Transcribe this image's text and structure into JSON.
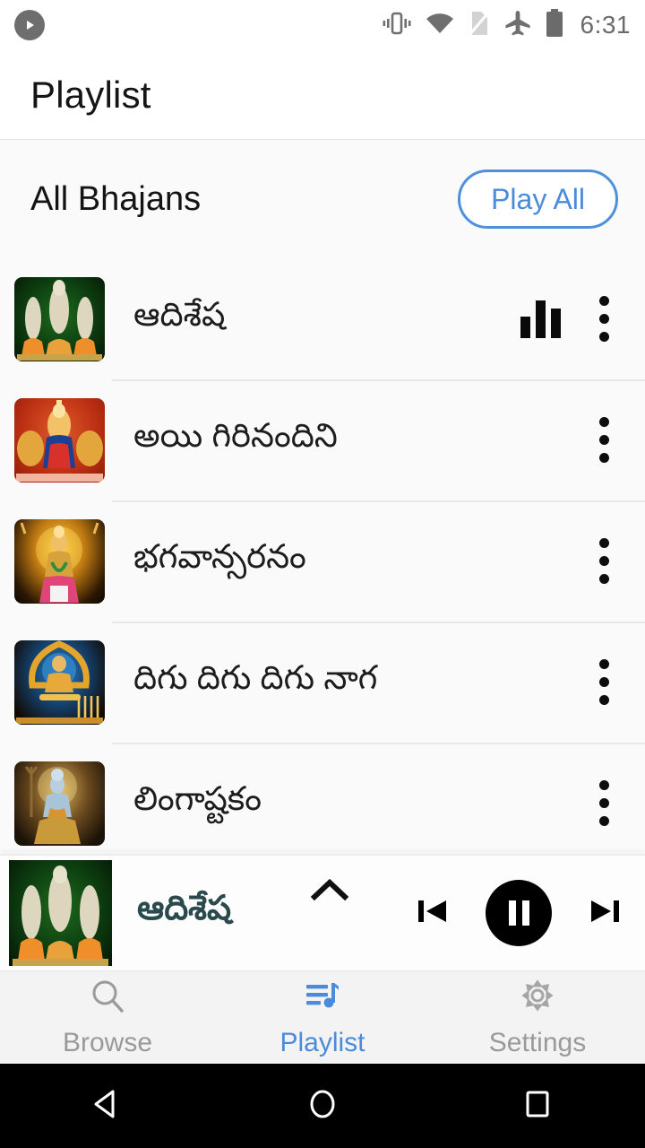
{
  "statusbar": {
    "time": "6:31",
    "icons": [
      "play-badge-icon",
      "vibrate-icon",
      "wifi-icon",
      "no-sim-icon",
      "airplane-mode-icon",
      "battery-icon"
    ]
  },
  "appbar": {
    "title": "Playlist"
  },
  "section": {
    "title": "All Bhajans",
    "play_all_label": "Play All",
    "accent_color": "#4a8cdb"
  },
  "list": {
    "rows": [
      {
        "title": "ఆదిశేష",
        "art": "art-green",
        "playing": true,
        "menu": "more-vert-icon"
      },
      {
        "title": "అయి గిరినందిని",
        "art": "art-red",
        "playing": false,
        "menu": "more-vert-icon"
      },
      {
        "title": "భగవాన్సరనం",
        "art": "art-gold",
        "playing": false,
        "menu": "more-vert-icon"
      },
      {
        "title": "దిగు దిగు దిగు నాగ",
        "art": "art-blue",
        "playing": false,
        "menu": "more-vert-icon"
      },
      {
        "title": "లింగాష్టకం",
        "art": "art-shiva",
        "playing": false,
        "menu": "more-vert-icon"
      }
    ]
  },
  "miniplayer": {
    "title": "ఆదిశేష",
    "expand_icon": "chevron-up-icon",
    "prev_icon": "skip-previous-icon",
    "play_state_icon": "pause-icon",
    "next_icon": "skip-next-icon",
    "title_color": "#2b4a4d"
  },
  "bottomnav": {
    "items": [
      {
        "label": "Browse",
        "icon": "search-icon",
        "active": false
      },
      {
        "label": "Playlist",
        "icon": "queue-music-icon",
        "active": true
      },
      {
        "label": "Settings",
        "icon": "gear-icon",
        "active": false
      }
    ],
    "active_color": "#4a8cdb",
    "inactive_color": "#9a9a9a"
  },
  "androidnav": {
    "back": "back-triangle-icon",
    "home": "home-circle-icon",
    "recents": "recents-square-icon"
  }
}
